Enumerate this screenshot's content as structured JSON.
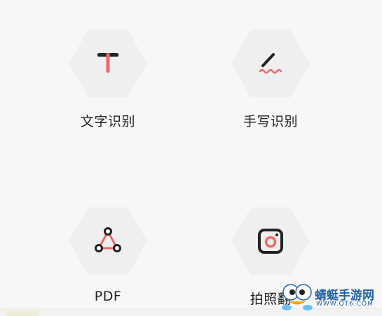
{
  "features": [
    {
      "label": "文字识别",
      "icon": "text-recognition-icon"
    },
    {
      "label": "手写识别",
      "icon": "handwriting-icon"
    },
    {
      "label": "PDF",
      "icon": "pdf-icon"
    },
    {
      "label": "拍照翻",
      "icon": "camera-icon"
    }
  ],
  "watermark": {
    "title": "蜻蜓手游网",
    "url": "WWW.QT6.COM"
  },
  "colors": {
    "accent": "#f06767",
    "background": "#f7f7f7",
    "hex": "#efefef",
    "watermark": "#1e5fa8"
  }
}
